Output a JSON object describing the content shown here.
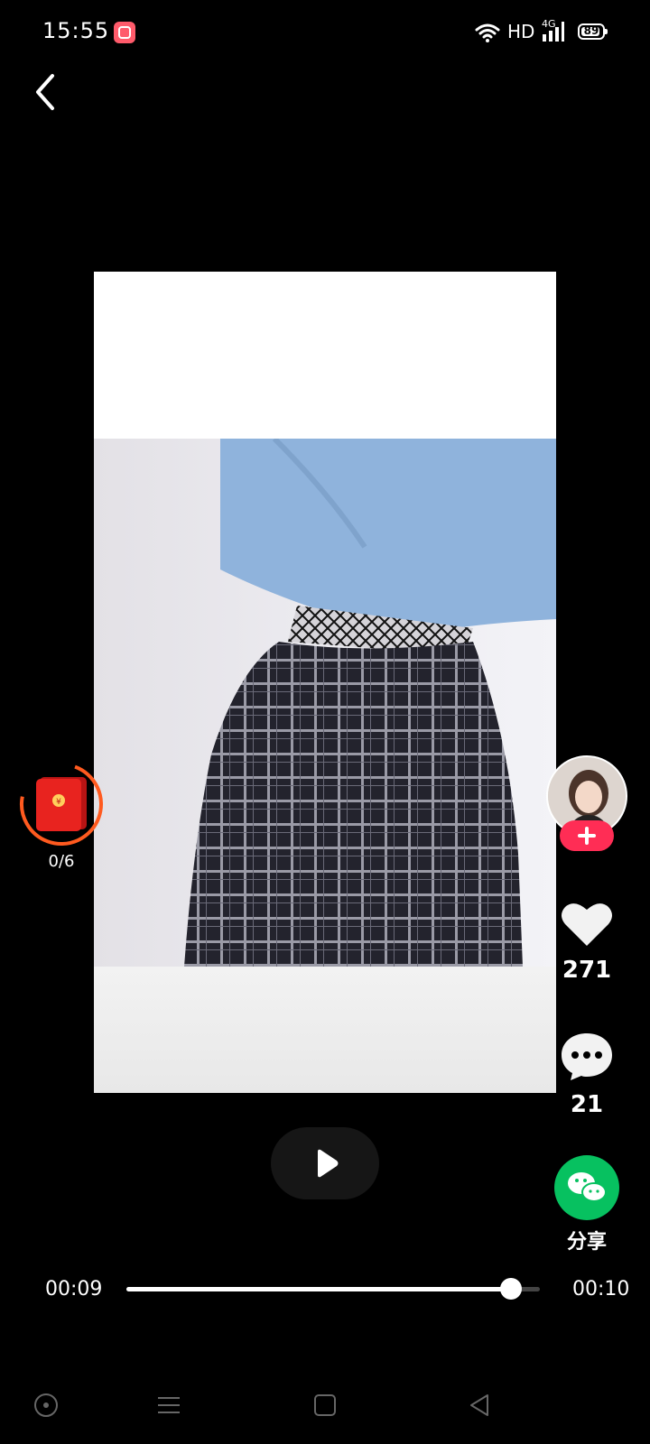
{
  "status_bar": {
    "time": "15:55",
    "network_label": "HD",
    "signal_type": "4G",
    "battery": "89",
    "battery_level_percent": 89
  },
  "red_packet": {
    "progress": "0/6"
  },
  "actions": {
    "likes": "271",
    "comments": "21",
    "share_label": "分享"
  },
  "player": {
    "elapsed": "00:09",
    "duration": "00:10",
    "progress_fraction": 0.93
  },
  "colors": {
    "follow_button": "#ff2d55",
    "share_green": "#07c160",
    "red_packet": "#e8231f",
    "ring_orange": "#ff5a1f"
  },
  "icons": {
    "back": "chevron-left-icon",
    "like": "heart-icon",
    "comment": "comment-bubble-icon",
    "share": "wechat-icon",
    "play": "play-icon",
    "follow": "plus-icon"
  }
}
